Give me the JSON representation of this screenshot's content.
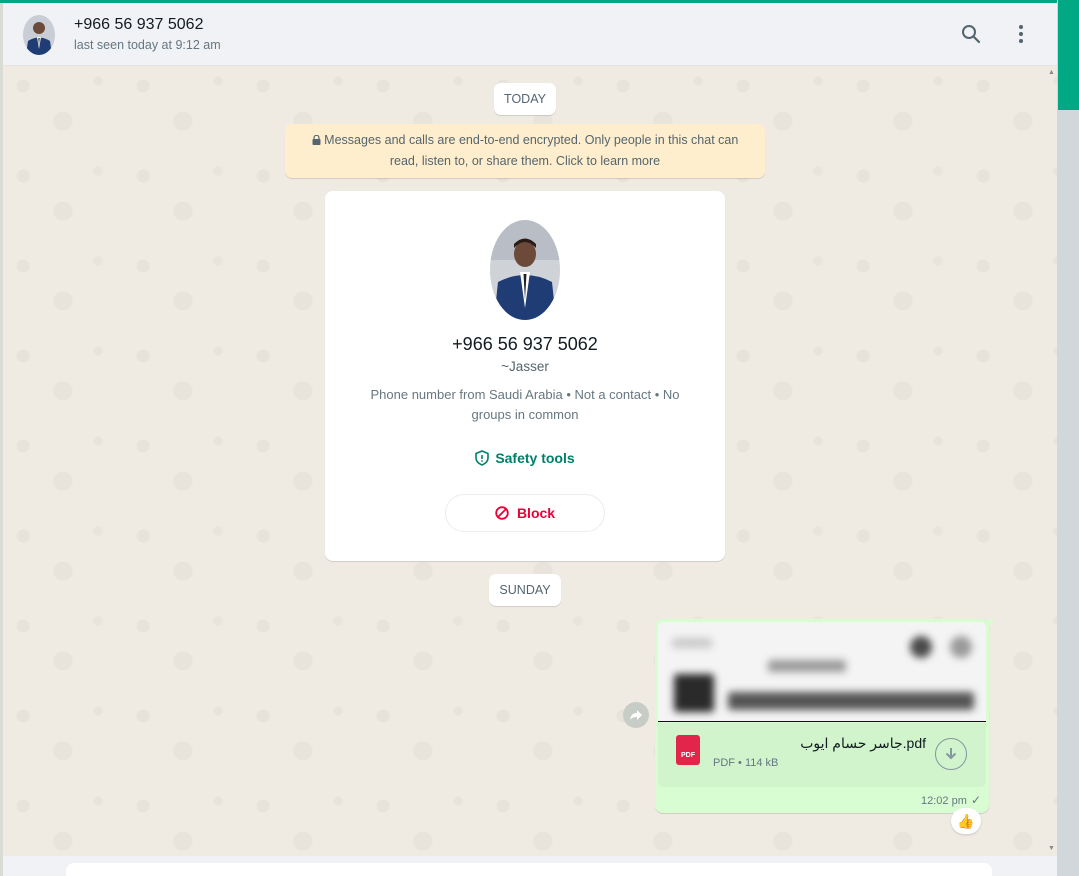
{
  "header": {
    "contact_phone": "+966 56 937 5062",
    "last_seen": "last seen today at 9:12 am",
    "search_icon": "search-icon",
    "menu_icon": "kebab-menu-icon"
  },
  "chat": {
    "date_today": "TODAY",
    "encryption_notice": "Messages and calls are end-to-end encrypted. Only people in this chat can read, listen to, or share them. Click to learn more",
    "contact_card": {
      "phone": "+966 56 937 5062",
      "name": "~Jasser",
      "description": "Phone number from Saudi Arabia • Not a contact • No groups in common",
      "safety_label": "Safety tools",
      "block_label": "Block"
    },
    "date_sunday": "SUNDAY",
    "message": {
      "file_name": "جاسر حسام ايوب.pdf",
      "file_type_badge": "PDF",
      "file_meta": "PDF • 114 kB",
      "time": "12:02 pm",
      "status": "✓",
      "reaction": "👍"
    }
  },
  "colors": {
    "accent": "#00a884",
    "outgoing_bubble": "#d9fdd3",
    "block_red": "#ea0038",
    "safety_green": "#008069"
  }
}
